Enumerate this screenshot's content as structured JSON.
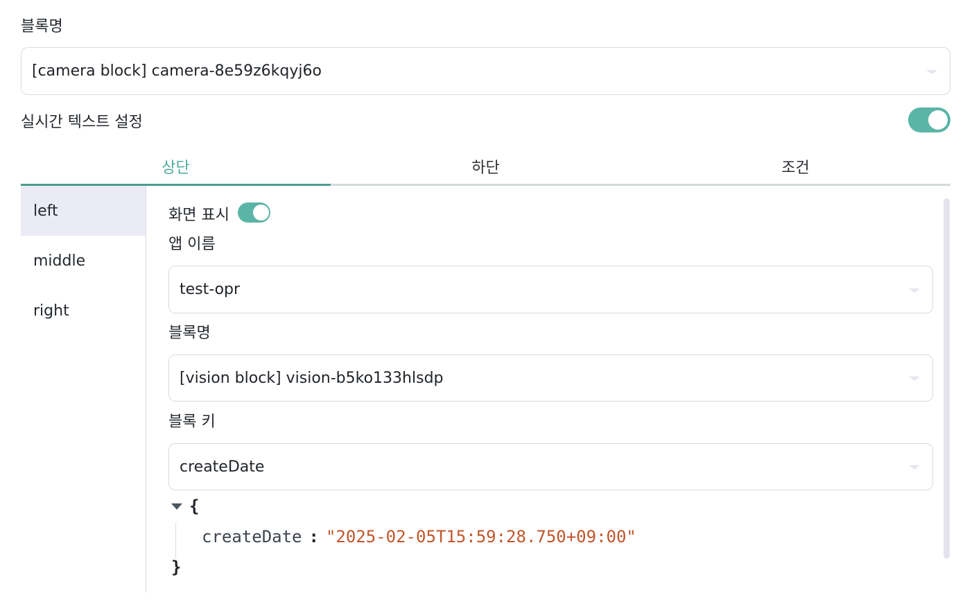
{
  "top": {
    "block_label": "블록명",
    "block_select_value": "[camera block] camera-8e59z6kqyj6o",
    "realtime_label": "실시간 텍스트 설정",
    "realtime_enabled": true
  },
  "tabs": [
    {
      "label": "상단",
      "active": true
    },
    {
      "label": "하단",
      "active": false
    },
    {
      "label": "조건",
      "active": false
    }
  ],
  "sidebar": {
    "items": [
      {
        "label": "left",
        "active": true
      },
      {
        "label": "middle",
        "active": false
      },
      {
        "label": "right",
        "active": false
      }
    ]
  },
  "panel": {
    "display_label": "화면 표시",
    "display_enabled": true,
    "app_name_label": "앱 이름",
    "app_name_value": "test-opr",
    "block_label": "블록명",
    "block_value": "[vision block] vision-b5ko133hlsdp",
    "block_key_label": "블록 키",
    "block_key_value": "createDate"
  },
  "json_preview": {
    "open_brace": "{",
    "close_brace": "}",
    "key": "createDate",
    "colon": ":",
    "value": "\"2025-02-05T15:59:28.750+09:00\""
  },
  "colors": {
    "accent": "#5bb5a6",
    "active_tab_text": "#4ea89b",
    "json_string": "#c0562a",
    "sidebar_active_bg": "#ebebf6"
  }
}
